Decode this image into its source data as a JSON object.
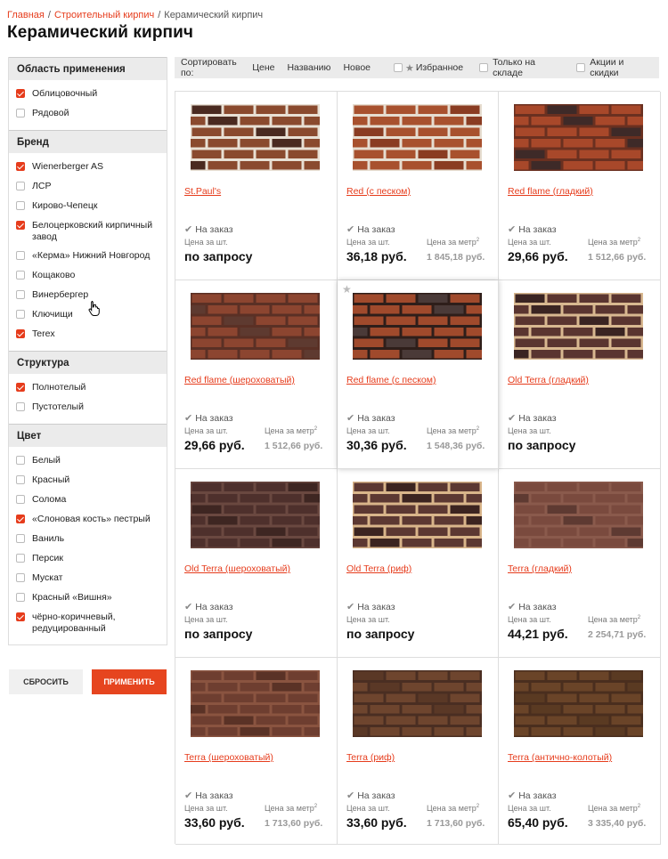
{
  "breadcrumbs": [
    "Главная",
    "Строительный кирпич",
    "Керамический кирпич"
  ],
  "page_title": "Керамический кирпич",
  "filters": [
    {
      "title": "Область применения",
      "items": [
        {
          "label": "Облицовочный",
          "checked": true
        },
        {
          "label": "Рядовой",
          "checked": false
        }
      ]
    },
    {
      "title": "Бренд",
      "items": [
        {
          "label": "Wienerberger AS",
          "checked": true
        },
        {
          "label": "ЛСР",
          "checked": false
        },
        {
          "label": "Кирово-Чепецк",
          "checked": false
        },
        {
          "label": "Белоцерковский кирпичный завод",
          "checked": true
        },
        {
          "label": "«Керма» Нижний Новгород",
          "checked": false
        },
        {
          "label": "Кощаково",
          "checked": false
        },
        {
          "label": "Винербергер",
          "checked": false
        },
        {
          "label": "Ключищи",
          "checked": false
        },
        {
          "label": "Terex",
          "checked": true
        }
      ]
    },
    {
      "title": "Структура",
      "items": [
        {
          "label": "Полнотелый",
          "checked": true
        },
        {
          "label": "Пустотелый",
          "checked": false
        }
      ]
    },
    {
      "title": "Цвет",
      "items": [
        {
          "label": "Белый",
          "checked": false
        },
        {
          "label": "Красный",
          "checked": false
        },
        {
          "label": "Солома",
          "checked": false
        },
        {
          "label": "«Слоновая кость» пестрый",
          "checked": true
        },
        {
          "label": "Ваниль",
          "checked": false
        },
        {
          "label": "Персик",
          "checked": false
        },
        {
          "label": "Мускат",
          "checked": false
        },
        {
          "label": "Красный «Вишня»",
          "checked": false
        },
        {
          "label": "чёрно-коричневый, редуцированный",
          "checked": true
        }
      ]
    }
  ],
  "buttons": {
    "reset": "СБРОСИТЬ",
    "apply": "ПРИМЕНИТЬ"
  },
  "sortbar": {
    "label": "Сортировать по:",
    "options": [
      "Цене",
      "Названию",
      "Новое"
    ],
    "favorites": "Избранное",
    "in_stock": "Только на складе",
    "sales": "Акции и скидки"
  },
  "product_labels": {
    "order": "На заказ",
    "price_unit": "Цена за шт.",
    "price_m2": "Цена за метр",
    "m2_sup": "2"
  },
  "products": [
    {
      "name": "St.Paul's",
      "price": "по запросу",
      "price_m2": "",
      "brick": "#8a4a2e",
      "mortar": "#e8e0d4",
      "dark": "#4a2a20"
    },
    {
      "name": "Red (с песком)",
      "price": "36,18 руб.",
      "price_m2": "1 845,18 руб.",
      "brick": "#a8512e",
      "mortar": "#e6ddd0",
      "dark": "#8a3c22"
    },
    {
      "name": "Red flame (гладкий)",
      "price": "29,66 руб.",
      "price_m2": "1 512,66 руб.",
      "brick": "#a8482a",
      "mortar": "#6a3020",
      "dark": "#3e2a28"
    },
    {
      "name": "Red flame (шероховатый)",
      "price": "29,66 руб.",
      "price_m2": "1 512,66 руб.",
      "brick": "#8c4530",
      "mortar": "#5a3025",
      "dark": "#5e3a30"
    },
    {
      "name": "Red flame (с песком)",
      "price": "30,36 руб.",
      "price_m2": "1 548,36 руб.",
      "brick": "#a04a2c",
      "mortar": "#2e1e1a",
      "dark": "#4a3a38"
    },
    {
      "name": "Old Terra (гладкий)",
      "price": "по запросу",
      "price_m2": "",
      "brick": "#5a3530",
      "mortar": "#d8b890",
      "dark": "#3a2422"
    },
    {
      "name": "Old Terra (шероховатый)",
      "price": "по запросу",
      "price_m2": "",
      "brick": "#4e302c",
      "mortar": "#6a4840",
      "dark": "#3e2622"
    },
    {
      "name": "Old Terra (риф)",
      "price": "по запросу",
      "price_m2": "",
      "brick": "#5c3832",
      "mortar": "#d9b58a",
      "dark": "#3c2420"
    },
    {
      "name": "Terra (гладкий)",
      "price": "44,21 руб.",
      "price_m2": "2 254,71 руб.",
      "brick": "#7a4a3e",
      "mortar": "#8a5a4c",
      "dark": "#5e3a32"
    },
    {
      "name": "Terra (шероховатый)",
      "price": "33,60 руб.",
      "price_m2": "1 713,60 руб.",
      "brick": "#6e3e30",
      "mortar": "#8a5440",
      "dark": "#5a3226"
    },
    {
      "name": "Terra (риф)",
      "price": "33,60 руб.",
      "price_m2": "1 713,60 руб.",
      "brick": "#6e452e",
      "mortar": "#4a2e22",
      "dark": "#5a3826"
    },
    {
      "name": "Terra (антично-колотый)",
      "price": "65,40 руб.",
      "price_m2": "3 335,40 руб.",
      "brick": "#6a4428",
      "mortar": "#4a2e1e",
      "dark": "#5a3a22"
    }
  ],
  "colors": {
    "accent": "#e63c1c",
    "button_apply": "#e6451f",
    "panel_header": "#ebebeb"
  },
  "icons": [
    "checkbox-icon",
    "star-icon",
    "checkmark-icon",
    "hand-cursor-icon"
  ]
}
